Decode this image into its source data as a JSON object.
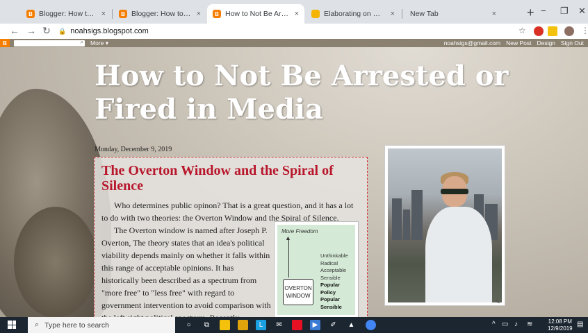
{
  "browser": {
    "tabs": [
      {
        "title": "Blogger: How to Not Be Arrest",
        "favicon": "blogger-icon"
      },
      {
        "title": "Blogger: How to Not Be Arrest",
        "favicon": "blogger-icon"
      },
      {
        "title": "How to Not Be Arrested or Fire",
        "favicon": "blogger-icon"
      },
      {
        "title": "Elaborating on my Favorite Bl",
        "favicon": "slides-icon"
      },
      {
        "title": "New Tab",
        "favicon": ""
      }
    ],
    "close_glyph": "×",
    "new_tab_glyph": "+",
    "url": "noahsigs.blogspot.com",
    "minimize": "−",
    "restore": "❐",
    "close": "✕"
  },
  "blogger_nav": {
    "more": "More ▾",
    "email": "noahsigs@gmail.com",
    "new_post": "New Post",
    "design": "Design",
    "sign_out": "Sign Out"
  },
  "blog": {
    "title": "How to Not Be Arrested or Fired in Media",
    "date": "Monday, December 9, 2019",
    "post_title": "The Overton Window and the Spiral of Silence",
    "para1": "Who determines public opinon? That is a great question, and it has a lot to do with two theories: the Overton Window and the Spiral of Silence.",
    "para2": "The Overton window is named after Joseph P. Overton, The theory states that an idea's political viability depends mainly on whether it falls within this range of acceptable opinions. It has historically been described as a spectrum from \"more free\" to \"less free\" with regard to government intervention to avoid comparison with the left-right political spectrum. Recently,"
  },
  "overton_diagram": {
    "top_label": "More Freedom",
    "box_line1": "OVERTON",
    "box_line2": "WINDOW",
    "items": [
      "Unthinkable",
      "Radical",
      "Acceptable",
      "Sensible",
      "Popular",
      "Policy",
      "Popular",
      "Sensible"
    ]
  },
  "taskbar": {
    "search_placeholder": "Type here to search",
    "time": "12:08 PM",
    "date": "12/9/2019"
  }
}
